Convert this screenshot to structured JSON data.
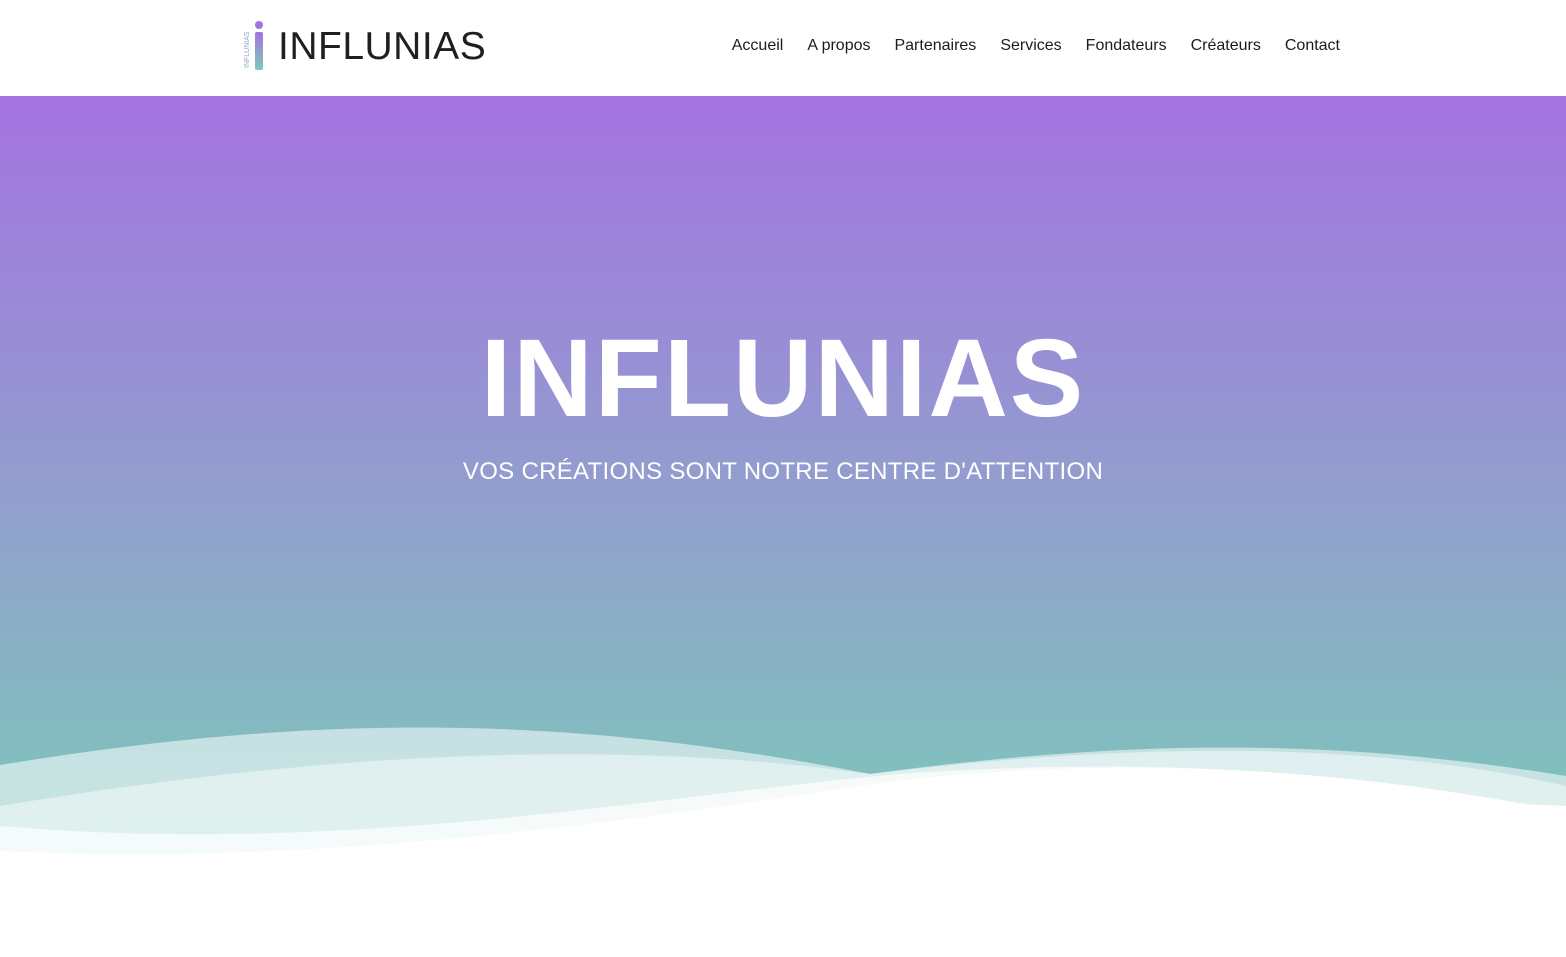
{
  "brand": {
    "name": "INFLUNIAS",
    "logo_icon": "influnias-logo-mark"
  },
  "nav": {
    "items": [
      {
        "label": "Accueil"
      },
      {
        "label": "A propos"
      },
      {
        "label": "Partenaires"
      },
      {
        "label": "Services"
      },
      {
        "label": "Fondateurs"
      },
      {
        "label": "Créateurs"
      },
      {
        "label": "Contact"
      }
    ]
  },
  "hero": {
    "title": "INFLUNIAS",
    "subtitle": "VOS CRÉATIONS SONT NOTRE CENTRE D'ATTENTION"
  },
  "colors": {
    "gradient_top": "#a473e0",
    "gradient_bottom": "#7dcbba",
    "text_dark": "#1f1f1f",
    "white": "#ffffff"
  }
}
